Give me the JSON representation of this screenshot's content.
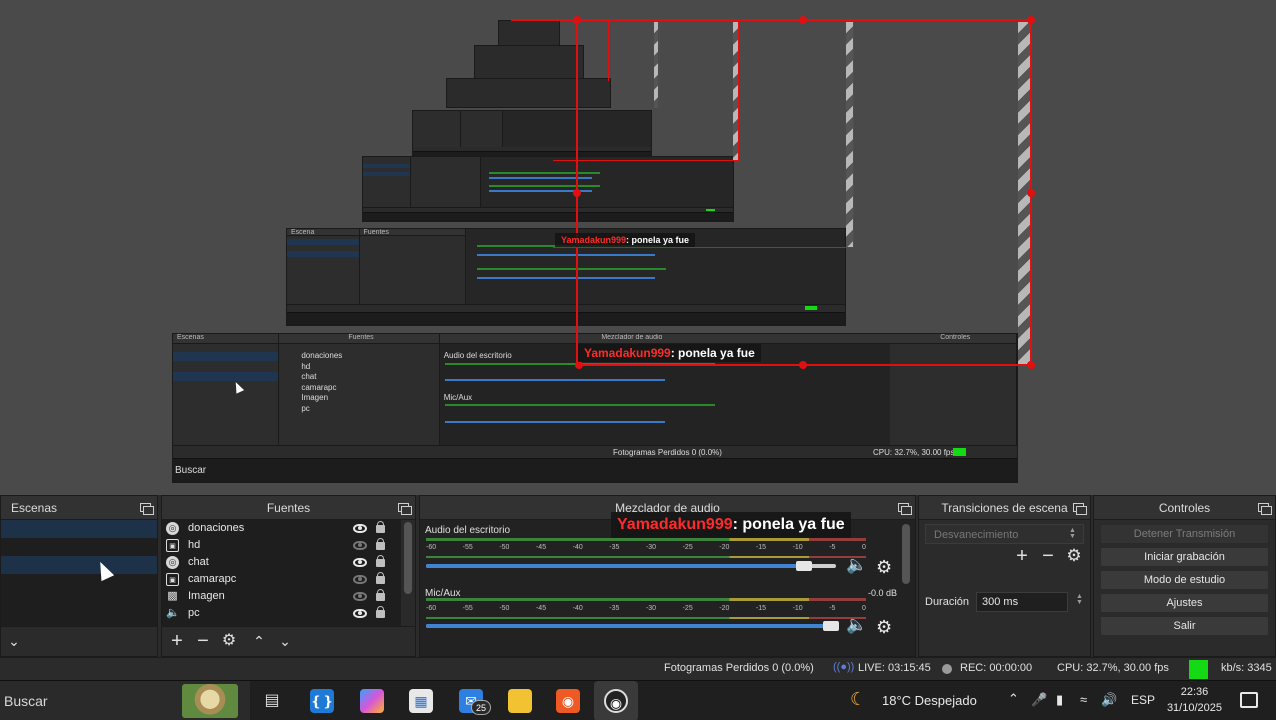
{
  "docks": {
    "scenes": {
      "title": "Escenas"
    },
    "sources": {
      "title": "Fuentes",
      "items": [
        {
          "name": "donaciones",
          "icon": "globe-icon",
          "visible": true
        },
        {
          "name": "hd",
          "icon": "camera-icon",
          "visible": false
        },
        {
          "name": "chat",
          "icon": "globe-icon",
          "visible": true
        },
        {
          "name": "camarapc",
          "icon": "camera-icon",
          "visible": false
        },
        {
          "name": "Imagen",
          "icon": "image-icon",
          "visible": false
        },
        {
          "name": "pc",
          "icon": "speaker-icon",
          "visible": true
        }
      ]
    },
    "mixer": {
      "title": "Mezclador de audio",
      "tracks": [
        {
          "name": "Audio del escritorio",
          "db": "",
          "volume": 0.93
        },
        {
          "name": "Mic/Aux",
          "db": "-0.0 dB",
          "volume": 1.0
        }
      ],
      "ticks": [
        "-60",
        "-55",
        "-50",
        "-45",
        "-40",
        "-35",
        "-30",
        "-25",
        "-20",
        "-15",
        "-10",
        "-5",
        "0"
      ]
    },
    "transitions": {
      "title": "Transiciones de escena",
      "selected": "Desvanecimiento",
      "duration_label": "Duración",
      "duration_value": "300 ms"
    },
    "controls": {
      "title": "Controles",
      "buttons": [
        "Detener Transmisión",
        "Iniciar grabación",
        "Modo de estudio",
        "Ajustes",
        "Salir"
      ]
    }
  },
  "chat_overlay": {
    "user": "Yamadakun999",
    "message": ": ponela ya fue"
  },
  "statusbar": {
    "dropped": "Fotogramas Perdidos 0 (0.0%)",
    "live": "LIVE: 03:15:45",
    "rec": "REC: 00:00:00",
    "cpu": "CPU: 32.7%, 30.00 fps",
    "kbps": "kb/s: 3345"
  },
  "taskbar": {
    "search_placeholder": "Buscar",
    "weather": "18°C  Despejado",
    "lang": "ESP",
    "time": "22:36",
    "date": "31/10/2025",
    "mail_badge": "25"
  },
  "colors": {
    "accent": "#3f84d3",
    "live_green": "#16d916",
    "overlay_red": "#e01010",
    "chat_user": "#ff2b2b"
  }
}
